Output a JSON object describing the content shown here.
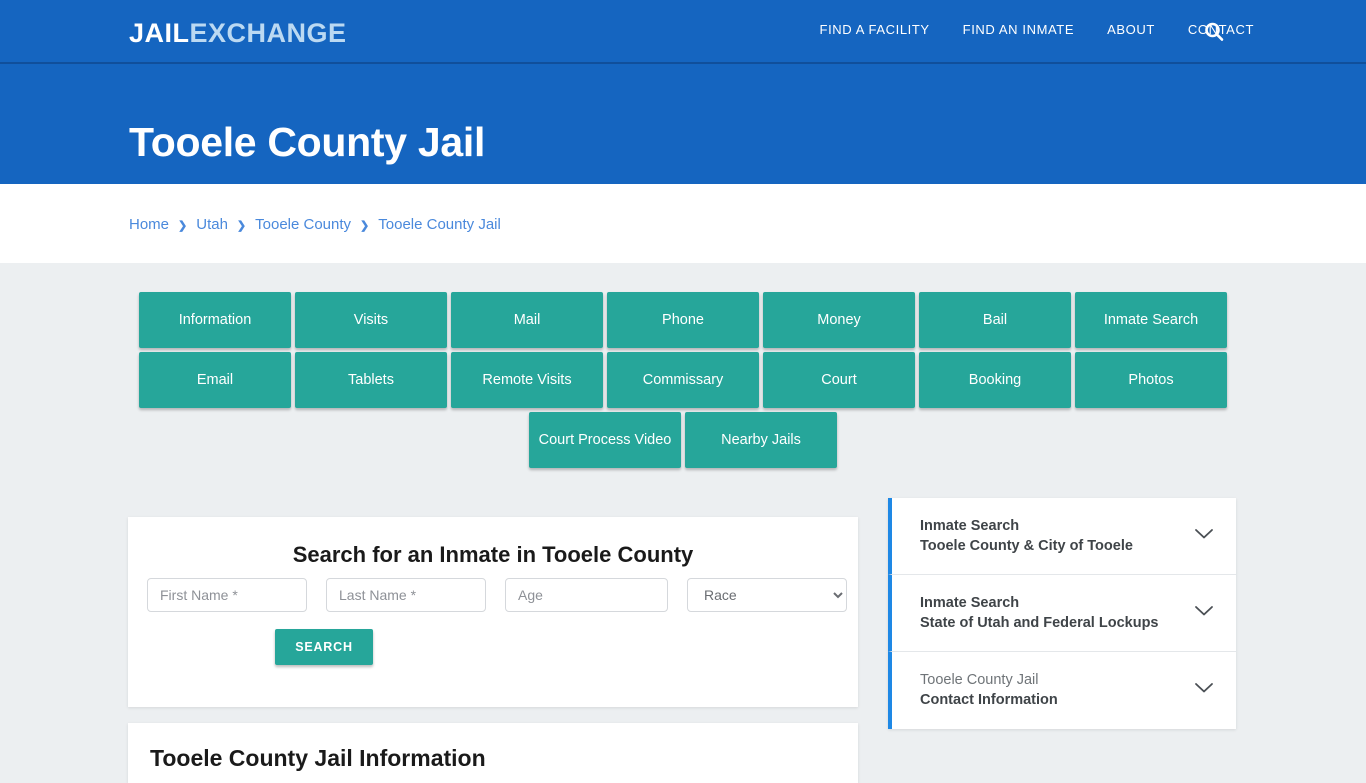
{
  "header": {
    "logo_primary": "JAIL",
    "logo_secondary": "EXCHANGE",
    "nav": [
      {
        "label": "FIND A FACILITY"
      },
      {
        "label": "FIND AN INMATE"
      },
      {
        "label": "ABOUT"
      },
      {
        "label": "CONTACT"
      }
    ],
    "search_icon": "search-icon"
  },
  "page": {
    "title": "Tooele County Jail"
  },
  "breadcrumb": {
    "separator": "❯",
    "items": [
      {
        "label": "Home"
      },
      {
        "label": "Utah"
      },
      {
        "label": "Tooele County"
      },
      {
        "label": "Tooele County Jail"
      }
    ]
  },
  "nav_buttons": [
    {
      "label": "Information"
    },
    {
      "label": "Visits"
    },
    {
      "label": "Mail"
    },
    {
      "label": "Phone"
    },
    {
      "label": "Money"
    },
    {
      "label": "Bail"
    },
    {
      "label": "Inmate Search"
    },
    {
      "label": "Email"
    },
    {
      "label": "Tablets"
    },
    {
      "label": "Remote Visits"
    },
    {
      "label": "Commissary"
    },
    {
      "label": "Court"
    },
    {
      "label": "Booking"
    },
    {
      "label": "Photos"
    },
    {
      "label": "Court Process Video"
    },
    {
      "label": "Nearby Jails"
    }
  ],
  "inmate_search": {
    "heading": "Search for an Inmate in Tooele County",
    "first_name_placeholder": "First Name *",
    "first_name_value": "",
    "last_name_placeholder": "Last Name *",
    "last_name_value": "",
    "age_placeholder": "Age",
    "age_value": "",
    "race_selected": "Race",
    "race_options": [
      "Race"
    ],
    "submit_label": "SEARCH"
  },
  "sidebar": {
    "panels": [
      {
        "line1": "Inmate Search",
        "line2": "Tooele County & City of Tooele",
        "line1_light": false,
        "icon": "chevron-down-icon"
      },
      {
        "line1": "Inmate Search",
        "line2": "State of Utah and Federal Lockups",
        "line1_light": false,
        "icon": "chevron-down-icon"
      },
      {
        "line1": "Tooele County Jail",
        "line2": "Contact Information",
        "line1_light": true,
        "icon": "chevron-down-icon"
      }
    ]
  },
  "info_section": {
    "heading": "Tooele County Jail Information"
  },
  "colors": {
    "header_blue": "#1565c0",
    "teal": "#26a69a",
    "page_bg": "#eceff1",
    "link_blue": "#4a89dc",
    "accent_blue": "#1e88e5"
  }
}
